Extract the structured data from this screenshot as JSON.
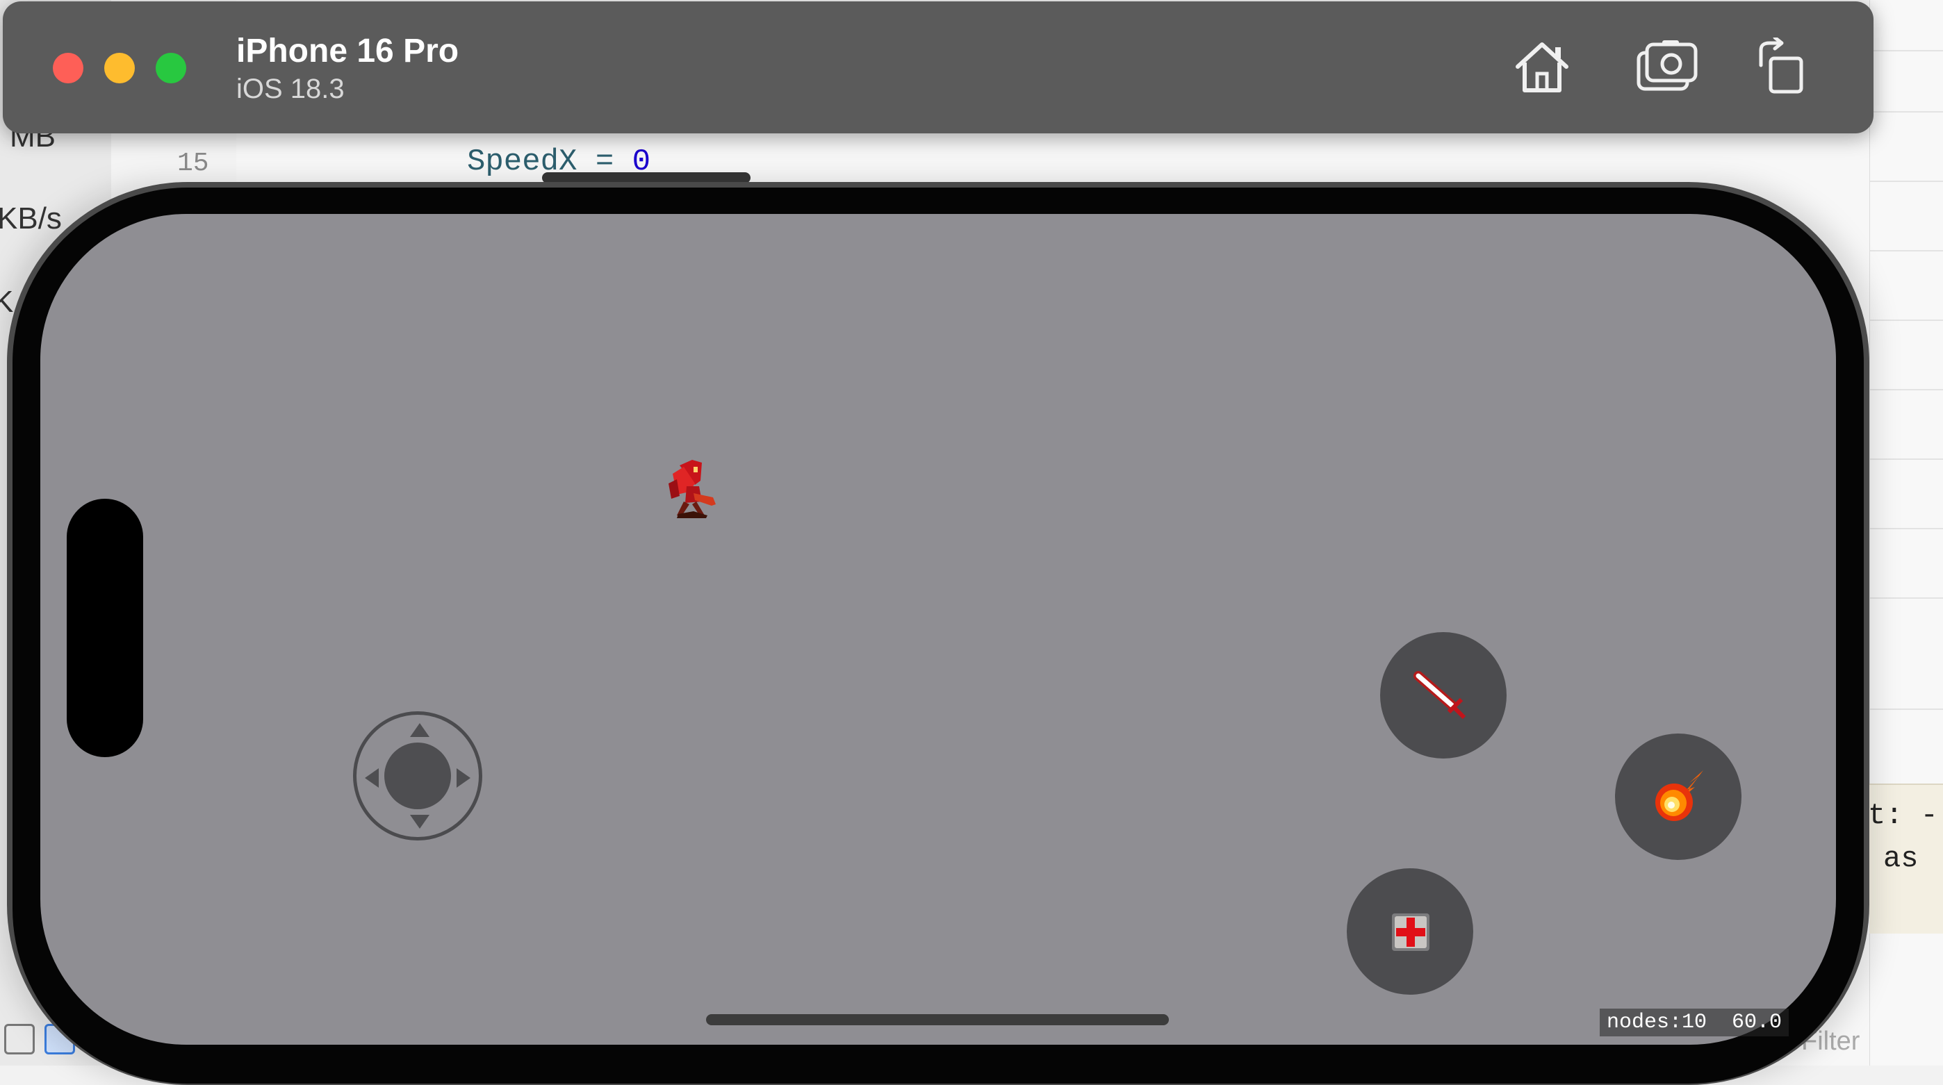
{
  "simulator": {
    "device_name": "iPhone 16 Pro",
    "os_version": "iOS 18.3",
    "toolbar": [
      "home-icon",
      "screenshot-icon",
      "rotate-icon"
    ]
  },
  "background": {
    "sidebar_texts": [
      "MB",
      "KB/s",
      "K"
    ],
    "line_number": "15",
    "code": {
      "identifier": "SpeedX",
      "operator": " = ",
      "value": "0"
    },
    "console_lines": [
      "t: -",
      "as"
    ],
    "filter_placeholder": "Filter"
  },
  "game": {
    "background_color": "#8f8e93",
    "buttons": [
      "sword-icon",
      "fireball-icon",
      "health-pack-icon"
    ],
    "stats": {
      "nodes": "nodes:10",
      "fps": "60.0"
    }
  }
}
